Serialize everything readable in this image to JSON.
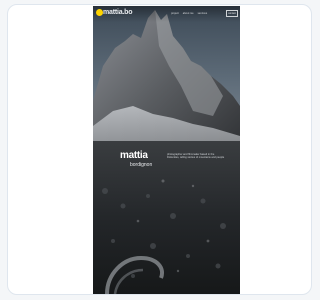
{
  "site": {
    "logo_text": "mattia.bo",
    "nav": [
      "project",
      "about me",
      "services"
    ],
    "nav_cta": "contact"
  },
  "hero": {
    "title": "mattia",
    "subtitle": "bordignon",
    "body": "photographer and filmmaker based in the Dolomites, telling stories of mountains and people"
  }
}
